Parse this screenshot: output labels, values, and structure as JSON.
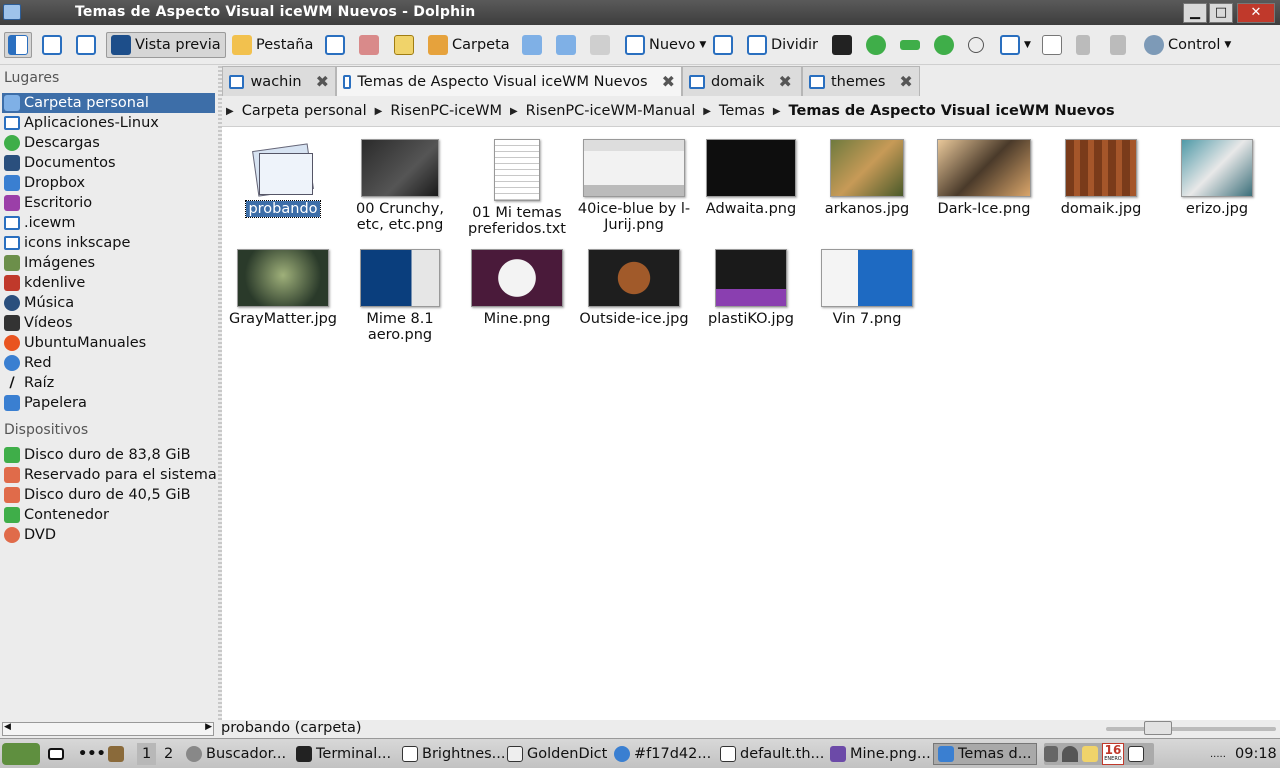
{
  "window": {
    "title": "Temas de Aspecto Visual iceWM Nuevos - Dolphin"
  },
  "window_controls": {
    "minimize": "▁",
    "maximize": "□",
    "close": "✕"
  },
  "toolbar": {
    "preview": "Vista previa",
    "tab": "Pestaña",
    "folder": "Carpeta",
    "new": "Nuevo",
    "split": "Dividir",
    "control": "Control"
  },
  "sidebar": {
    "places_heading": "Lugares",
    "places": [
      "Carpeta personal",
      "Aplicaciones-Linux",
      "Descargas",
      "Documentos",
      "Dropbox",
      "Escritorio",
      ".icewm",
      "icons inkscape",
      "Imágenes",
      "kdenlive",
      "Música",
      "Vídeos",
      "UbuntuManuales",
      "Red",
      "Raíz",
      "Papelera"
    ],
    "devices_heading": "Dispositivos",
    "devices": [
      "Disco duro de 83,8 GiB",
      "Reservado para el sistema",
      "Disco duro de 40,5 GiB",
      "Contenedor",
      "DVD"
    ]
  },
  "tabs": [
    "wachin",
    "Temas de Aspecto Visual iceWM Nuevos",
    "domaik",
    "themes"
  ],
  "breadcrumb": [
    "Carpeta personal",
    "RisenPC-iceWM",
    "RisenPC-iceWM-Manual",
    "Temas",
    "Temas de Aspecto Visual iceWM Nuevos"
  ],
  "files": [
    {
      "name": "probando"
    },
    {
      "name": "00 Crunchy, etc, etc.png"
    },
    {
      "name": "01 Mi temas preferidos.txt"
    },
    {
      "name": "40ice-blue by l-Jurij.png"
    },
    {
      "name": "Adwaita.png"
    },
    {
      "name": "arkanos.jpg"
    },
    {
      "name": "Dark-Ice.png"
    },
    {
      "name": "domaik.jpg"
    },
    {
      "name": "erizo.jpg"
    },
    {
      "name": "GrayMatter.jpg"
    },
    {
      "name": "Mime 8.1 aero.png"
    },
    {
      "name": "Mine.png"
    },
    {
      "name": "Outside-ice.jpg"
    },
    {
      "name": "plastiKO.jpg"
    },
    {
      "name": "Vin 7.png"
    }
  ],
  "status": {
    "text": "probando (carpeta)"
  },
  "taskbar": {
    "desktops": [
      "1",
      "2"
    ],
    "tasks": [
      "Buscador...",
      "Terminal...",
      "Brightnes...",
      "GoldenDict",
      "#f17d42...",
      "default.th...",
      "Mine.png...",
      "Temas d..."
    ],
    "clock": "09:18",
    "calendar_day": "16",
    "calendar_month": "ENERO"
  },
  "colors": {
    "selection": "#3d6ea8",
    "titlebar": "#4a4a4a"
  }
}
